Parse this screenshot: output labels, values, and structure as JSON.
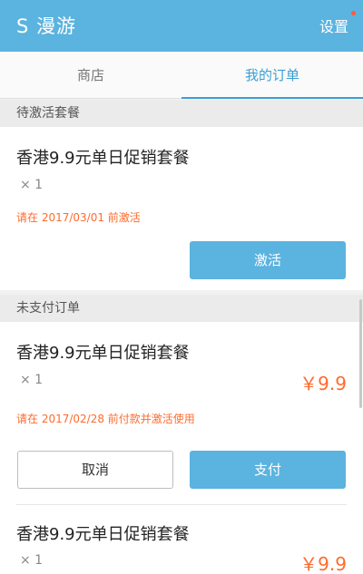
{
  "appbar": {
    "title": "S 漫游",
    "settings_label": "设置"
  },
  "tabs": [
    {
      "label": "商店",
      "active": false
    },
    {
      "label": "我的订单",
      "active": true
    }
  ],
  "sections": {
    "pending_activation": {
      "header": "待激活套餐",
      "item": {
        "name": "香港9.9元单日促销套餐",
        "qty": "× 1",
        "notice": "请在 2017/03/01 前激活",
        "activate_label": "激活"
      }
    },
    "unpaid": {
      "header": "未支付订单",
      "items": [
        {
          "name": "香港9.9元单日促销套餐",
          "qty": "× 1",
          "price": "￥9.9",
          "notice": "请在 2017/02/28 前付款并激活使用",
          "cancel_label": "取消",
          "pay_label": "支付"
        },
        {
          "name": "香港9.9元单日促销套餐",
          "qty": "× 1",
          "price": "￥9.9"
        }
      ]
    }
  },
  "colors": {
    "primary": "#5bb3df",
    "tab_active": "#3a9fd4",
    "accent_orange": "#ff6b2c",
    "notification_dot": "#ff5a3c"
  }
}
